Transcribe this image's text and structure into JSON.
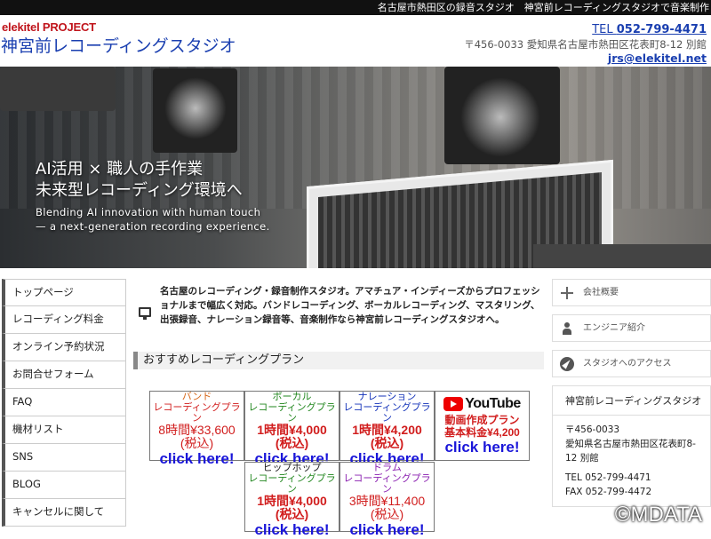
{
  "topbar": {
    "text": "名古屋市熱田区の録音スタジオ　神宮前レコーディングスタジオで音楽制作"
  },
  "header": {
    "brand_small": "elekitel PROJECT",
    "brand_big": "神宮前レコーディングスタジオ",
    "tel_label": "TEL ",
    "tel_number": "052-799-4471",
    "address": "〒456-0033 愛知県名古屋市熱田区花表町8-12 別館",
    "email": "jrs@elekitel.net"
  },
  "hero": {
    "line1": "AI活用 × 職人の手作業",
    "line2": "未来型レコーディング環境へ",
    "en1": "Blending AI innovation with human touch",
    "en2": "— a next-generation recording experience."
  },
  "leftnav": {
    "items": [
      "トップページ",
      "レコーディング料金",
      "オンライン予約状況",
      "お問合せフォーム",
      "FAQ",
      "機材リスト",
      "SNS",
      "BLOG",
      "キャンセルに関して"
    ]
  },
  "main": {
    "intro": "名古屋のレコーディング・録音制作スタジオ。アマチュア・インディーズからプロフェッショナルまで幅広く対応。バンドレコーディング、ボーカルレコーディング、マスタリング、出張録音、ナレーション録音等、音楽制作なら神宮前レコーディングスタジオへ。",
    "section_title": "おすすめレコーディングプラン",
    "plans": [
      {
        "cat": "バンド",
        "name": "レコーディングプラン",
        "price": "8時間¥33,600",
        "tax": "(税込)",
        "click": "click here!"
      },
      {
        "cat": "ボーカル",
        "name": "レコーディングプラン",
        "price": "1時間¥4,000",
        "tax": "(税込)",
        "click": "click here!"
      },
      {
        "cat": "ナレーション",
        "name": "レコーディングプラン",
        "price": "1時間¥4,200",
        "tax": "(税込)",
        "click": "click here!"
      },
      {
        "logo": "YouTube",
        "name": "動画作成プラン",
        "price": "基本料金¥4,200",
        "click": "click here!"
      },
      {
        "cat": "ヒップホップ",
        "name": "レコーディングプラン",
        "price": "1時間¥4,000",
        "tax": "(税込)",
        "click": "click here!"
      },
      {
        "cat": "ドラム",
        "name": "レコーディングプラン",
        "price": "3時間¥11,400",
        "tax": "(税込)",
        "click": "click here!"
      }
    ]
  },
  "right": {
    "buttons": [
      "会社概要",
      "エンジニア紹介",
      "スタジオへのアクセス"
    ],
    "card_title": "神宮前レコーディングスタジオ",
    "card_lines": [
      "〒456-0033",
      "愛知県名古屋市熱田区花表町8-12 別館",
      "TEL 052-799-4471",
      "FAX 052-799-4472"
    ]
  },
  "watermark": "©MDATA",
  "colors": {
    "brand_red": "#c0141b",
    "link_blue": "#1a3fb0",
    "click_blue": "#1a16d9"
  }
}
